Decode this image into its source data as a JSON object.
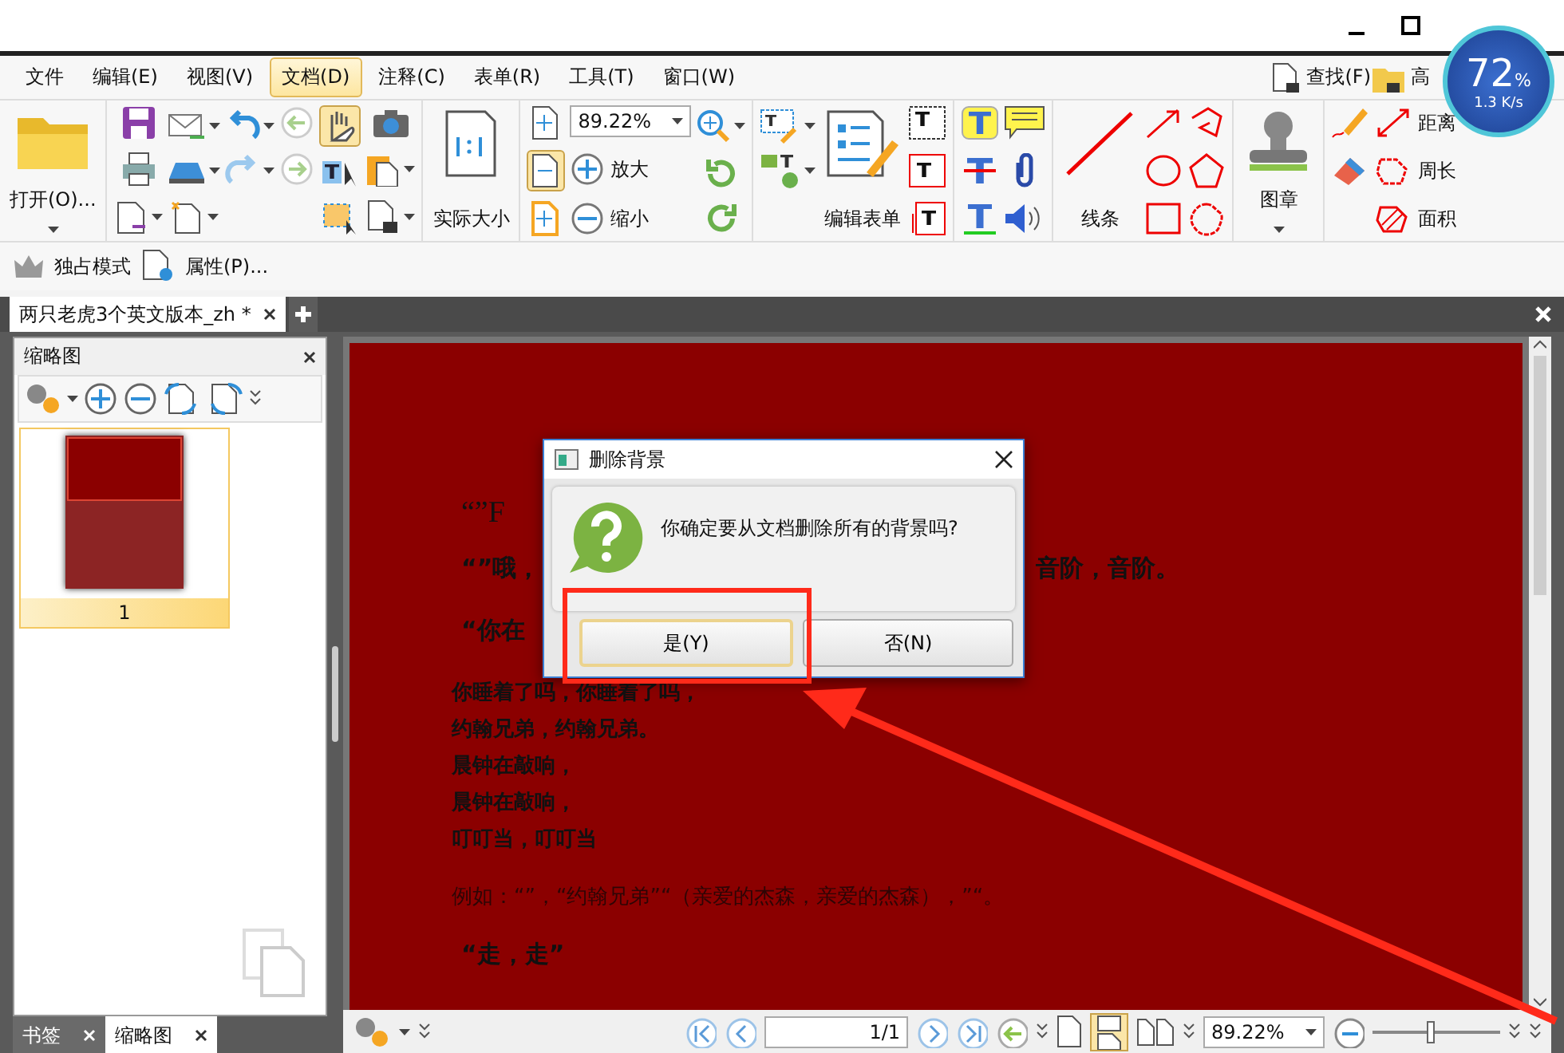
{
  "menu": {
    "items": [
      {
        "label": "文件",
        "selected": false
      },
      {
        "label": "编辑(E)",
        "selected": false
      },
      {
        "label": "视图(V)",
        "selected": false
      },
      {
        "label": "文档(D)",
        "selected": true
      },
      {
        "label": "注释(C)",
        "selected": false
      },
      {
        "label": "表单(R)",
        "selected": false
      },
      {
        "label": "工具(T)",
        "selected": false
      },
      {
        "label": "窗口(W)",
        "selected": false
      }
    ],
    "find": "查找(F)",
    "advanced_find": "高"
  },
  "monitor_widget": {
    "percent": "72",
    "unit": "%",
    "speed": "1.3 K/s"
  },
  "ribbon": {
    "open": "打开(O)...",
    "hand_tool": {
      "selected": true
    },
    "actual_size": "实际大小",
    "zoom": "89.22%",
    "fit_width": {
      "selected": true
    },
    "zoom_in": "放大",
    "zoom_out": "缩小",
    "edit_form": "编辑表单",
    "line": "线条",
    "stamp": "图章",
    "distance": "距离",
    "perimeter": "周长",
    "area": "面积"
  },
  "quick_bar": [
    "独占模式",
    "属性(P)..."
  ],
  "doc_tabs": [
    {
      "title": "两只老虎3个英文版本_zh *",
      "selected": true
    }
  ],
  "thumbnail_panel": {
    "title": "缩略图",
    "pages": [
      {
        "label": "1",
        "selected": true
      }
    ]
  },
  "panel_tabs": [
    {
      "label": "书签",
      "selected": false
    },
    {
      "label": "缩略图",
      "selected": true
    }
  ],
  "document": {
    "lines": [
      {
        "kind": "heading",
        "text": "“”F"
      },
      {
        "kind": "body",
        "text": "“”哦，",
        "right": "音阶，音阶。"
      },
      {
        "kind": "body",
        "text": "“你在"
      },
      {
        "kind": "verse",
        "text": "你睡着了吗，你睡着了吗，"
      },
      {
        "kind": "verse",
        "text": "约翰兄弟，约翰兄弟。"
      },
      {
        "kind": "verse",
        "text": "晨钟在敲响，"
      },
      {
        "kind": "verse",
        "text": "晨钟在敲响，"
      },
      {
        "kind": "verse",
        "text": "叮叮当，叮叮当"
      },
      {
        "kind": "faint",
        "text": "例如：“”，“约翰兄弟”“（亲爱的杰森，亲爱的杰森），”“。"
      },
      {
        "kind": "body",
        "text": "“走，走”"
      }
    ]
  },
  "dialog": {
    "title": "删除背景",
    "message": "你确定要从文档删除所有的背景吗?",
    "buttons": [
      {
        "label": "是(Y)",
        "selected": true
      },
      {
        "label": "否(N)",
        "selected": false
      }
    ]
  },
  "status_bar": {
    "page": "1/1",
    "continuous_view": {
      "selected": true
    },
    "zoom": "89.22%",
    "zoom_slider": {
      "level": 0.45
    }
  }
}
